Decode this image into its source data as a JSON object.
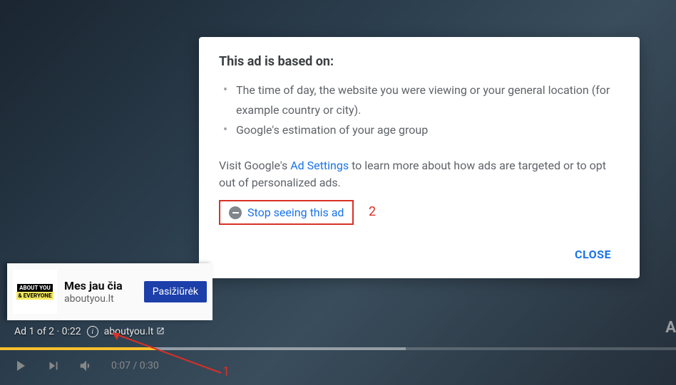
{
  "dialog": {
    "title": "This ad is based on:",
    "reasons": [
      "The time of day, the website you were viewing or your general location (for example country or city).",
      "Google's estimation of your age group"
    ],
    "visit_prefix": "Visit Google's ",
    "ad_settings_link": "Ad Settings",
    "visit_suffix": " to learn more about how ads are targeted or to opt out of personalized ads.",
    "stop_seeing": "Stop seeing this ad",
    "close": "CLOSE"
  },
  "ad_card": {
    "thumb_top": "ABOUT YOU",
    "thumb_bottom": "& EVERYONE",
    "headline": "Mes jau čia",
    "domain": "aboutyou.lt",
    "cta": "Pasižiūrėk"
  },
  "ad_status": {
    "text": "Ad 1 of 2 · 0:22",
    "info_char": "i",
    "domain": "aboutyou.lt"
  },
  "player": {
    "time": "0:07 / 0:30"
  },
  "annotations": {
    "one": "1",
    "two": "2"
  },
  "right_badge": "A"
}
